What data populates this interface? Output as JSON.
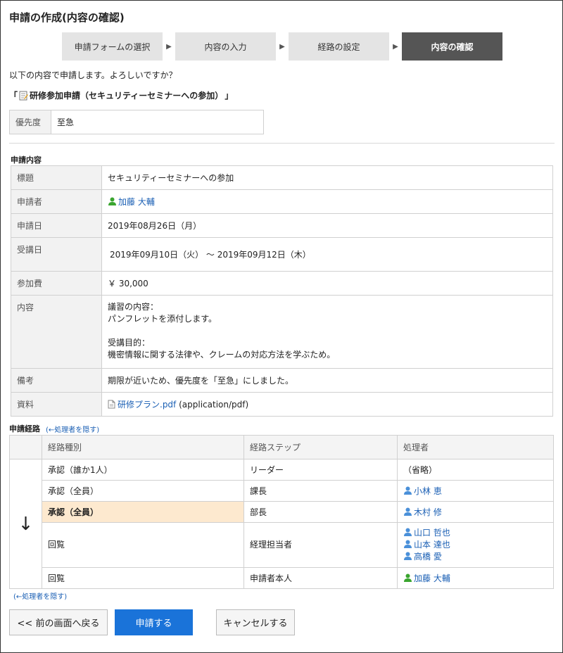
{
  "title": "申請の作成(内容の確認)",
  "steps": [
    "申請フォームの選択",
    "内容の入力",
    "経路の設定",
    "内容の確認"
  ],
  "confirm_message": "以下の内容で申請します。よろしいですか？",
  "form_name_open": "「",
  "form_name": "研修参加申請（セキュリティーセミナーへの参加）",
  "form_name_close": "」",
  "priority": {
    "label": "優先度",
    "value": "至急"
  },
  "content_section": "申請内容",
  "fields": {
    "subject": {
      "label": "標題",
      "value": "セキュリティーセミナーへの参加"
    },
    "applicant": {
      "label": "申請者",
      "value": "加藤 大輔"
    },
    "date": {
      "label": "申請日",
      "value": "2019年08月26日（月）"
    },
    "period": {
      "label": "受講日",
      "value": "2019年09月10日（火） ～ 2019年09月12日（木）"
    },
    "fee": {
      "label": "参加費",
      "value": "￥ 30,000"
    },
    "detail": {
      "label": "内容",
      "lines": [
        "議習の内容：",
        "パンフレットを添付します。",
        "",
        "受講目的：",
        "機密情報に関する法律や、クレームの対応方法を学ぶため。"
      ]
    },
    "note": {
      "label": "備考",
      "value": "期限が近いため、優先度を「至急」にしました。"
    },
    "attachment": {
      "label": "資料",
      "file": "研修プラン.pdf",
      "type": "(application/pdf)"
    }
  },
  "route": {
    "title": "申請経路",
    "hide_link": "(←処理者を隠す)",
    "headers": [
      "経路種別",
      "経路ステップ",
      "処理者"
    ],
    "arrow": "↓",
    "rows": [
      {
        "type": "承認（誰か1人）",
        "step": "リーダー",
        "processors": [],
        "note": "（省略）"
      },
      {
        "type": "承認（全員）",
        "step": "課長",
        "processors": [
          "小林 恵"
        ]
      },
      {
        "type": "承認（全員）",
        "step": "部長",
        "processors": [
          "木村 修"
        ]
      },
      {
        "type": "回覧",
        "step": "経理担当者",
        "processors": [
          "山口 哲也",
          "山本 達也",
          "高橋 愛"
        ]
      },
      {
        "type": "回覧",
        "step": "申請者本人",
        "processors": [
          "加藤 大輔"
        ]
      }
    ],
    "hide_link_bottom": "(←処理者を隠す)"
  },
  "buttons": {
    "back": "<< 前の画面へ戻る",
    "submit": "申請する",
    "cancel": "キャンセルする"
  },
  "colors": {
    "accent": "#1a73d9",
    "current_step": "#fde9cf",
    "link": "#1a5fb4"
  }
}
